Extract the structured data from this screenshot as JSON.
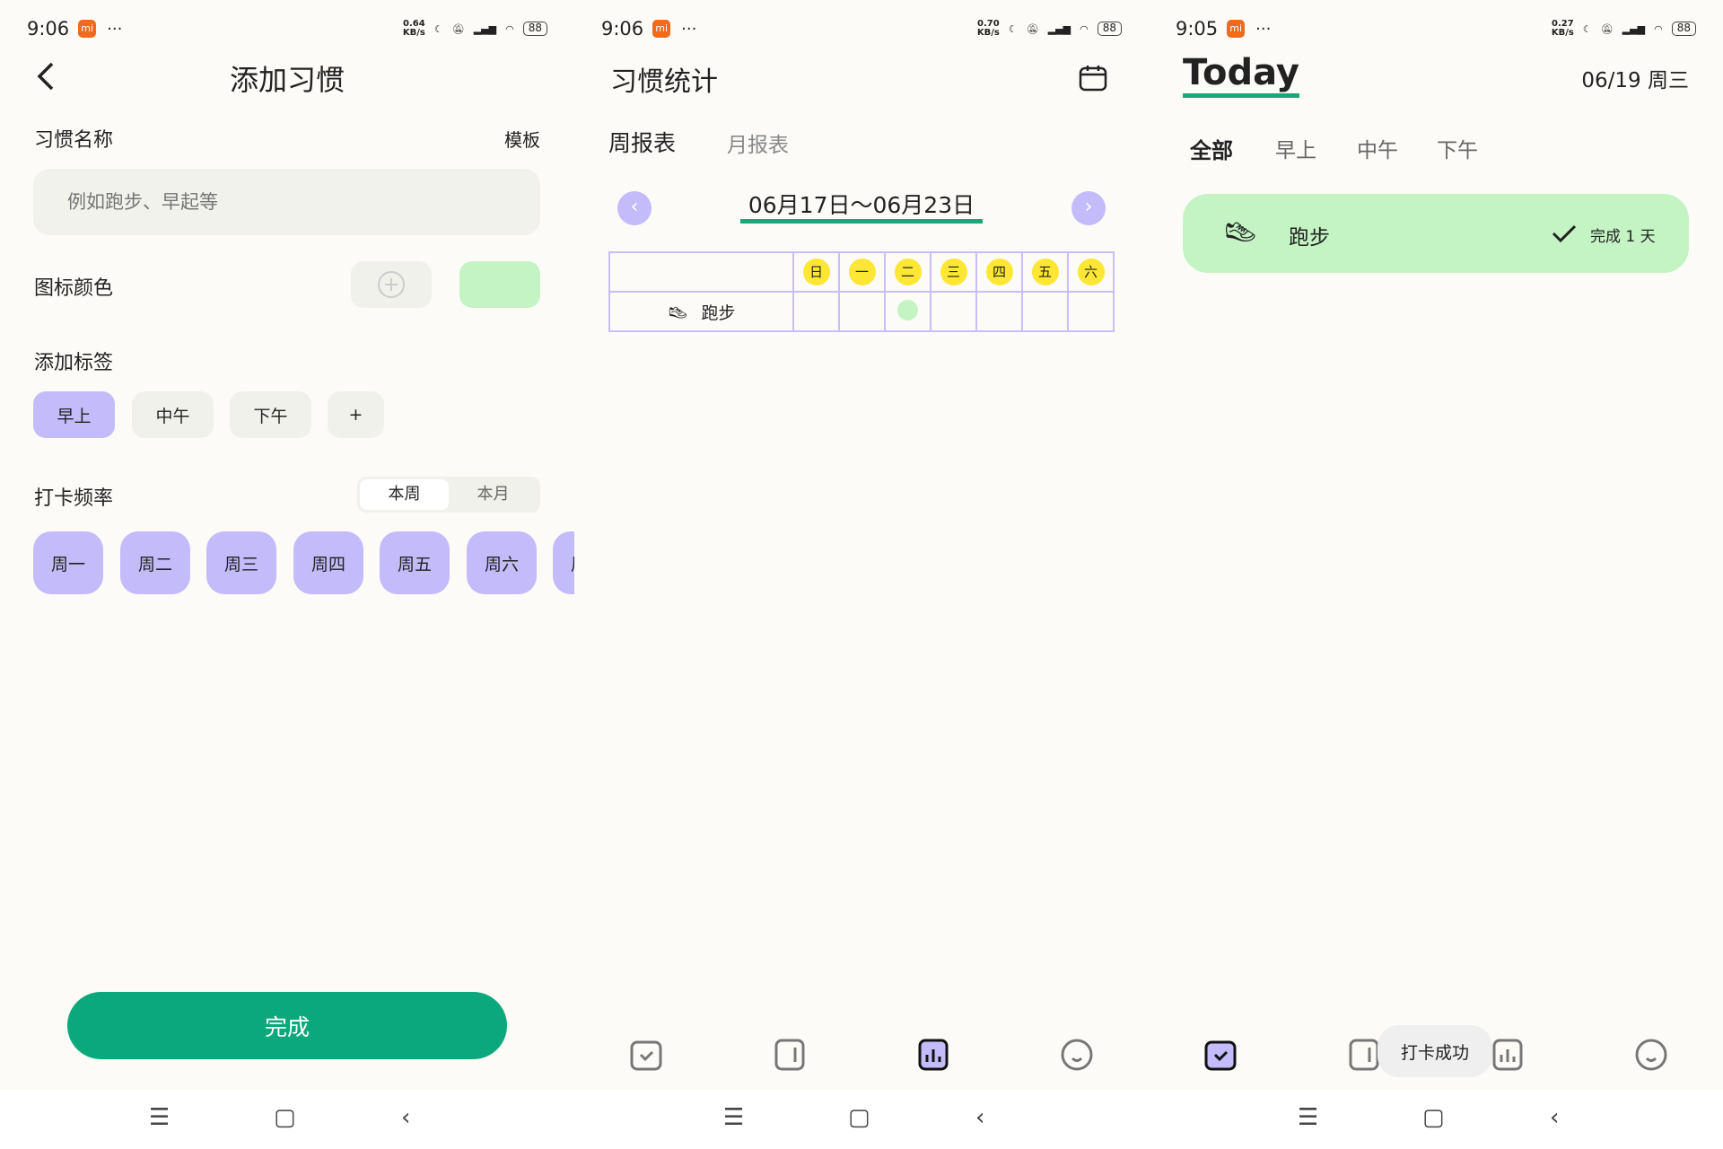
{
  "left": {
    "status": {
      "time": "9:06",
      "speed_top": "0.64",
      "speed_bottom": "KB/s",
      "battery": "88"
    },
    "title": "添加习惯",
    "name_label": "习惯名称",
    "template_link": "模板",
    "name_placeholder": "例如跑步、早起等",
    "icon_color_label": "图标颜色",
    "selected_color": "#c4f4c4",
    "tag_label": "添加标签",
    "tags": [
      {
        "label": "早上",
        "selected": true
      },
      {
        "label": "中午",
        "selected": false
      },
      {
        "label": "下午",
        "selected": false
      }
    ],
    "add_tag": "+",
    "frequency_label": "打卡频率",
    "frequency_options": [
      "本周",
      "本月"
    ],
    "frequency_selected": "本周",
    "days": [
      "周一",
      "周二",
      "周三",
      "周四",
      "周五",
      "周六",
      "周日"
    ],
    "done_button": "完成"
  },
  "middle": {
    "status": {
      "time": "9:06",
      "speed_top": "0.70",
      "speed_bottom": "KB/s",
      "battery": "88"
    },
    "title": "习惯统计",
    "tabs": [
      "周报表",
      "月报表"
    ],
    "active_tab": "周报表",
    "date_range": "06月17日～06月23日",
    "weekdays": [
      "日",
      "一",
      "二",
      "三",
      "四",
      "五",
      "六"
    ],
    "rows": [
      {
        "habit": "跑步",
        "done": [
          false,
          false,
          true,
          false,
          false,
          false,
          false
        ]
      }
    ]
  },
  "right": {
    "status": {
      "time": "9:05",
      "speed_top": "0.27",
      "speed_bottom": "KB/s",
      "battery": "88"
    },
    "title": "Today",
    "date": "06/19 周三",
    "filters": [
      "全部",
      "早上",
      "中午",
      "下午"
    ],
    "active_filter": "全部",
    "habit": {
      "name": "跑步",
      "status": "完成 1 天"
    },
    "toast": "打卡成功"
  },
  "colors": {
    "accent_green": "#0aa87a",
    "purple": "#c4bbfb",
    "done_green": "#c4f4c4",
    "weekday_yellow": "#fde734"
  }
}
